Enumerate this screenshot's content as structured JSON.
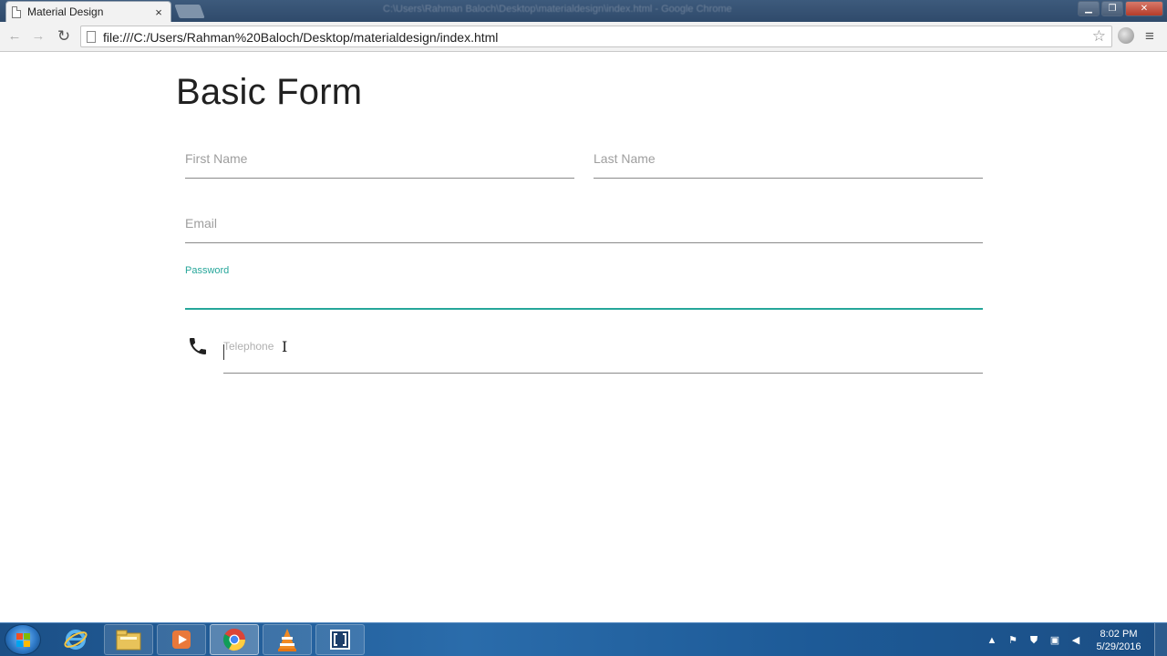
{
  "browser": {
    "tab_title": "Material Design",
    "tab_close": "×",
    "window_title": "C:\\Users\\Rahman Baloch\\Desktop\\materialdesign\\index.html - Google Chrome",
    "url": "file:///C:/Users/Rahman%20Baloch/Desktop/materialdesign/index.html",
    "window_controls": {
      "minimize": "▁",
      "maximize": "❐",
      "close": "✕"
    }
  },
  "page": {
    "title": "Basic Form",
    "fields": {
      "first_name": {
        "label": "First Name",
        "value": ""
      },
      "last_name": {
        "label": "Last Name",
        "value": ""
      },
      "email": {
        "label": "Email",
        "value": ""
      },
      "password": {
        "label": "Password",
        "value": ""
      },
      "telephone": {
        "label": "Telephone",
        "value": ""
      }
    },
    "colors": {
      "accent": "#26a69a",
      "label": "#9e9e9e",
      "title": "#212121",
      "underline": "#8a8a8a"
    }
  },
  "taskbar": {
    "apps": [
      "start-orb",
      "internet-explorer",
      "file-explorer",
      "media-player",
      "google-chrome",
      "vlc",
      "brackets"
    ],
    "active_app": "google-chrome",
    "clock": {
      "time": "8:02 PM",
      "date": "5/29/2016"
    }
  }
}
